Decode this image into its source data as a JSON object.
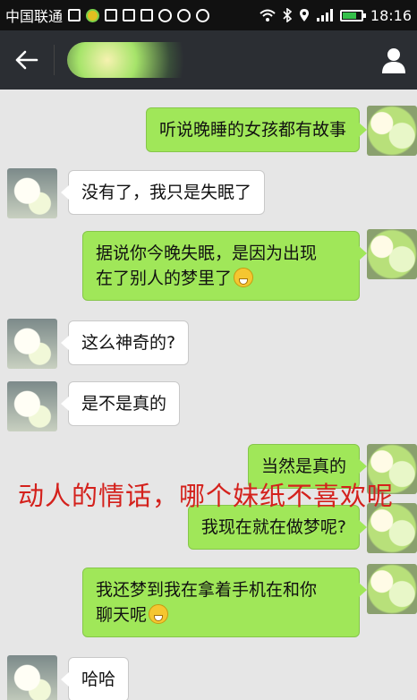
{
  "status_bar": {
    "carrier": "中国联通",
    "time": "18:16",
    "battery_level": 0.7,
    "icons": [
      "sim-card-icon",
      "app-notification-icon",
      "lock-icon",
      "gallery-icon",
      "message-icon",
      "headset-icon",
      "sync-icon",
      "usb-icon",
      "wifi-icon",
      "bluetooth-icon",
      "location-icon",
      "signal-icon",
      "battery-icon"
    ]
  },
  "title_bar": {
    "contact_name": "",
    "back_icon": "arrow-left-icon",
    "profile_icon": "person-icon"
  },
  "messages": [
    {
      "sender": "me",
      "text": "听说晚睡的女孩都有故事"
    },
    {
      "sender": "friend",
      "text": "没有了，我只是失眠了"
    },
    {
      "sender": "me",
      "text": "据说你今晚失眠，是因为出现",
      "text2": "在了别人的梦里了",
      "emoji": "grin-emoji"
    },
    {
      "sender": "friend",
      "text": "这么神奇的?"
    },
    {
      "sender": "friend",
      "text": "是不是真的"
    },
    {
      "sender": "me",
      "text": "当然是真的"
    },
    {
      "sender": "me",
      "text": "我现在就在做梦呢?"
    },
    {
      "sender": "me",
      "text": "我还梦到我在拿着手机在和你",
      "text2": "聊天呢",
      "emoji": "shy-emoji"
    },
    {
      "sender": "friend",
      "text": "哈哈"
    }
  ],
  "overlay_caption": "动人的情话，哪个妹纸不喜欢呢",
  "colors": {
    "outgoing_bubble": "#a0e759",
    "incoming_bubble": "#ffffff",
    "caption": "#d4211c",
    "title_bar": "#2b2e33",
    "chat_background": "#e6e6e6"
  }
}
